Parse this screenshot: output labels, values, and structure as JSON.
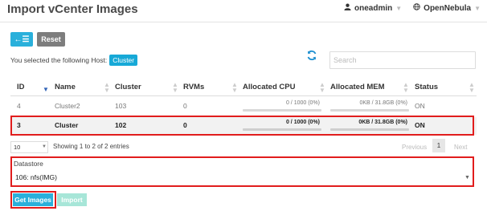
{
  "page": {
    "title": "Import vCenter Images"
  },
  "topnav": {
    "user": "oneadmin",
    "zone": "OpenNebula"
  },
  "toolbar": {
    "back_label": "←☰",
    "reset_label": "Reset"
  },
  "selection": {
    "prefix": "You selected the following Host:",
    "host": "Cluster"
  },
  "search": {
    "placeholder": "Search"
  },
  "table": {
    "columns": [
      "ID",
      "Name",
      "Cluster",
      "RVMs",
      "Allocated CPU",
      "Allocated MEM",
      "Status"
    ],
    "rows": [
      {
        "id": "4",
        "name": "Cluster2",
        "cluster": "103",
        "rvms": "0",
        "cpu": "0 / 1000 (0%)",
        "mem": "0KB / 31.8GB (0%)",
        "status": "ON",
        "cpu_fraction": 0,
        "mem_fraction": 0
      },
      {
        "id": "3",
        "name": "Cluster",
        "cluster": "102",
        "rvms": "0",
        "cpu": "0 / 1000 (0%)",
        "mem": "0KB / 31.8GB (0%)",
        "status": "ON",
        "cpu_fraction": 0,
        "mem_fraction": 0
      }
    ]
  },
  "pagination": {
    "page_length": "10",
    "info": "Showing 1 to 2 of 2 entries",
    "previous": "Previous",
    "current": "1",
    "next": "Next"
  },
  "datastore": {
    "label": "Datastore",
    "value": "106: nfs(IMG)"
  },
  "actions": {
    "get_images": "Get Images",
    "import": "Import"
  },
  "colors": {
    "accent": "#2ab0db",
    "highlight": "#e11d1d",
    "import_disabled": "#a7e6d8"
  },
  "icons": {
    "user": "user-icon",
    "zone": "globe-icon",
    "refresh": "refresh-icon"
  }
}
